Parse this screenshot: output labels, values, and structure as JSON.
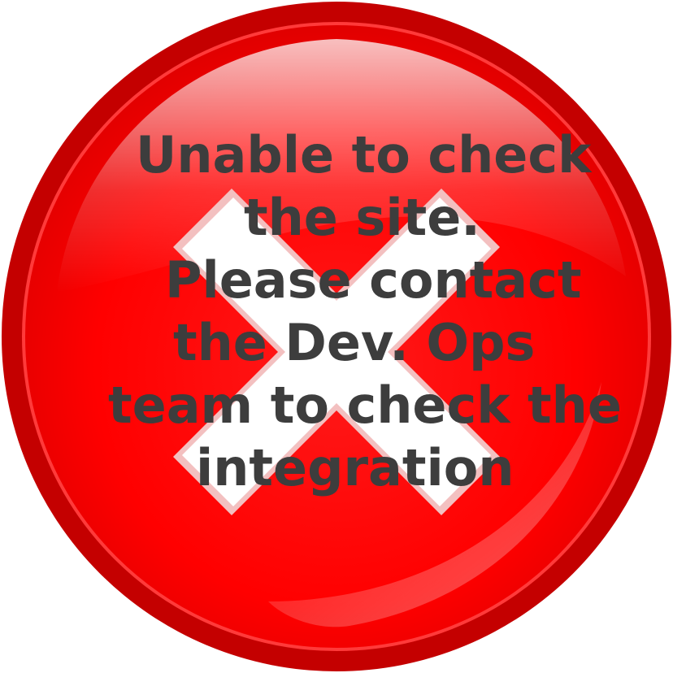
{
  "colors": {
    "outer_ring": "#c40000",
    "badge_fill": "#ff0000",
    "badge_dark": "#d80000",
    "cross_fill": "#ffffff",
    "cross_edge": "#f0b7b7",
    "text": "#3d3d3d"
  },
  "icons": {
    "badge": "error-badge-icon",
    "cross": "x-cross-icon"
  },
  "message": {
    "line1": "Unable to check",
    "line2": "the site.",
    "line3": "Please contact",
    "line4": "the Dev. Ops",
    "line5": "team to check the",
    "line6": "integration"
  }
}
